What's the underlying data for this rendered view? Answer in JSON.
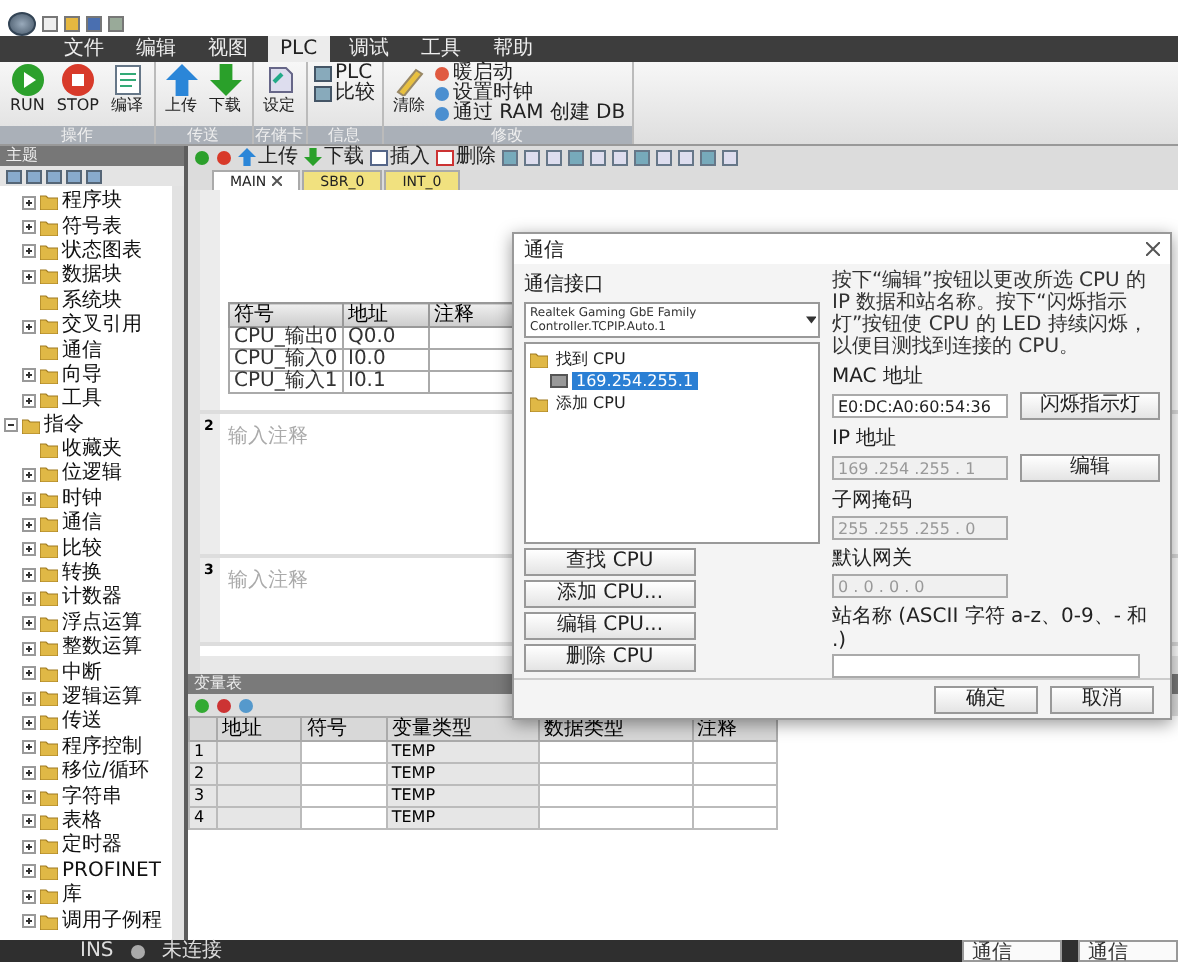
{
  "menu": [
    {
      "label": "文件",
      "selected": false
    },
    {
      "label": "编辑",
      "selected": false
    },
    {
      "label": "视图",
      "selected": false
    },
    {
      "label": "PLC",
      "selected": true
    },
    {
      "label": "调试",
      "selected": false
    },
    {
      "label": "工具",
      "selected": false
    },
    {
      "label": "帮助",
      "selected": false
    }
  ],
  "ribbon": [
    {
      "label": "操作",
      "items": [
        {
          "label": "RUN",
          "kind": "large"
        },
        {
          "label": "STOP",
          "kind": "large"
        },
        {
          "label": "编译",
          "kind": "large"
        }
      ]
    },
    {
      "label": "传送",
      "items": [
        {
          "label": "上传",
          "kind": "large"
        },
        {
          "label": "下载",
          "kind": "large"
        }
      ]
    },
    {
      "label": "存储卡",
      "items": [
        {
          "label": "设定",
          "kind": "large"
        }
      ]
    },
    {
      "label": "信息",
      "items": [
        {
          "label": "PLC",
          "kind": "small"
        },
        {
          "label": "比较",
          "kind": "small"
        }
      ]
    },
    {
      "label": "修改",
      "items": [
        {
          "label": "清除",
          "kind": "large"
        },
        {
          "label": "暖启动",
          "kind": "small"
        },
        {
          "label": "设置时钟",
          "kind": "small"
        },
        {
          "label": "通过 RAM 创建 DB",
          "kind": "small"
        }
      ]
    }
  ],
  "project_tree": {
    "title": "主题",
    "items": [
      {
        "label": "程序块",
        "expandable": true
      },
      {
        "label": "符号表",
        "expandable": true
      },
      {
        "label": "状态图表",
        "expandable": true
      },
      {
        "label": "数据块",
        "expandable": true
      },
      {
        "label": "系统块",
        "expandable": false
      },
      {
        "label": "交叉引用",
        "expandable": true
      },
      {
        "label": "通信",
        "expandable": false
      },
      {
        "label": "向导",
        "expandable": true
      },
      {
        "label": "工具",
        "expandable": true
      }
    ],
    "instructions": {
      "label": "指令",
      "expanded": true,
      "children": [
        {
          "label": "收藏夹",
          "expandable": false
        },
        {
          "label": "位逻辑",
          "expandable": true
        },
        {
          "label": "时钟",
          "expandable": true
        },
        {
          "label": "通信",
          "expandable": true
        },
        {
          "label": "比较",
          "expandable": true
        },
        {
          "label": "转换",
          "expandable": true
        },
        {
          "label": "计数器",
          "expandable": true
        },
        {
          "label": "浮点运算",
          "expandable": true
        },
        {
          "label": "整数运算",
          "expandable": true
        },
        {
          "label": "中断",
          "expandable": true
        },
        {
          "label": "逻辑运算",
          "expandable": true
        },
        {
          "label": "传送",
          "expandable": true
        },
        {
          "label": "程序控制",
          "expandable": true
        },
        {
          "label": "移位/循环",
          "expandable": true
        },
        {
          "label": "字符串",
          "expandable": true
        },
        {
          "label": "表格",
          "expandable": true
        },
        {
          "label": "定时器",
          "expandable": true
        },
        {
          "label": "PROFINET",
          "expandable": true
        },
        {
          "label": "库",
          "expandable": true
        },
        {
          "label": "调用子例程",
          "expandable": true
        }
      ]
    }
  },
  "editor_toolbar": {
    "actions": [
      {
        "label": "上传"
      },
      {
        "label": "下载"
      },
      {
        "label": "插入"
      },
      {
        "label": "删除"
      }
    ]
  },
  "editor_tabs": [
    {
      "label": "MAIN",
      "selected": true,
      "closable": true
    },
    {
      "label": "SBR_0",
      "selected": false,
      "closable": false
    },
    {
      "label": "INT_0",
      "selected": false,
      "closable": false
    }
  ],
  "networks": [
    {
      "symbols": {
        "columns": [
          "符号",
          "地址",
          "注释"
        ],
        "rows": [
          {
            "symbol": "CPU_输出0",
            "address": "Q0.0"
          },
          {
            "symbol": "CPU_输入0",
            "address": "I0.0"
          },
          {
            "symbol": "CPU_输入1",
            "address": "I0.1"
          }
        ]
      }
    },
    {
      "number": "2",
      "comment": "输入注释"
    },
    {
      "number": "3",
      "comment": "输入注释"
    }
  ],
  "variable_table": {
    "title": "变量表",
    "columns": [
      "地址",
      "符号",
      "变量类型",
      "数据类型",
      "注释"
    ],
    "rows": [
      {
        "number": "1",
        "type": "TEMP"
      },
      {
        "number": "2",
        "type": "TEMP"
      },
      {
        "number": "3",
        "type": "TEMP"
      },
      {
        "number": "4",
        "type": "TEMP"
      }
    ]
  },
  "status_bar": {
    "mode": "INS",
    "connection": "未连接",
    "previews": [
      {
        "title": "通信"
      },
      {
        "title": "通信"
      }
    ]
  },
  "dialog": {
    "title": "通信",
    "interface_label": "通信接口",
    "interface": "Realtek Gaming GbE Family Controller.TCPIP.Auto.1",
    "tree": {
      "label": "找到 CPU",
      "children": [
        {
          "label": "169.254.255.1",
          "selected": true
        }
      ],
      "add_label": "添加 CPU"
    },
    "info": "按下“编辑”按钮以更改所选 CPU 的 IP 数据和站名称。按下“闪烁指示灯”按钮使 CPU 的 LED 持续闪烁，以便目测找到连接的 CPU。",
    "fields": [
      {
        "label": "MAC 地址",
        "value": "E0:DC:A0:60:54:36",
        "button": "闪烁指示灯",
        "disabled": false
      },
      {
        "label": "IP 地址",
        "value": "169 .254 .255 . 1",
        "button": "编辑",
        "disabled": true
      },
      {
        "label": "子网掩码",
        "value": "255 .255 .255 . 0",
        "disabled": true
      },
      {
        "label": "默认网关",
        "value": "0 . 0 . 0 . 0",
        "disabled": true
      },
      {
        "label": "站名称 (ASCII 字符 a-z、0-9、- 和 .)",
        "disabled": false
      }
    ],
    "cpu_buttons": [
      "查找 CPU",
      "添加 CPU...",
      "编辑 CPU...",
      "删除 CPU"
    ],
    "buttons": [
      "确定",
      "取消"
    ]
  }
}
